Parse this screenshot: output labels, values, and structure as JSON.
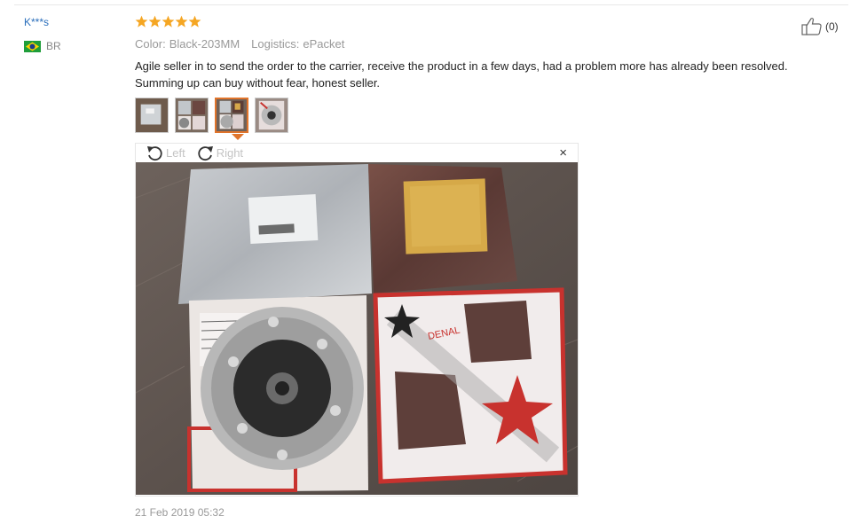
{
  "review": {
    "user_name": "K***s",
    "country_code": "BR",
    "rating": 5,
    "color_label": "Color:",
    "color_value": "Black-203MM",
    "logistics_label": "Logistics:",
    "logistics_value": "ePacket",
    "text": "Agile seller in to send the order to the carrier, receive the product in a few days, had a problem more has already been resolved. Summing up can buy without fear, honest seller.",
    "useful_count": "(0)",
    "date": "21 Feb 2019 05:32"
  },
  "viewer": {
    "rotate_left_label": "Left",
    "rotate_right_label": "Right",
    "close_label": "×",
    "active_thumb_index": 2
  },
  "colors": {
    "link": "#2a6ebb",
    "star": "#f5a623",
    "accent": "#e0742b",
    "muted": "#999999"
  },
  "icons": [
    "flag-icon",
    "star-icon",
    "thumbs-up-icon",
    "rotate-left-icon",
    "rotate-right-icon",
    "close-icon"
  ]
}
